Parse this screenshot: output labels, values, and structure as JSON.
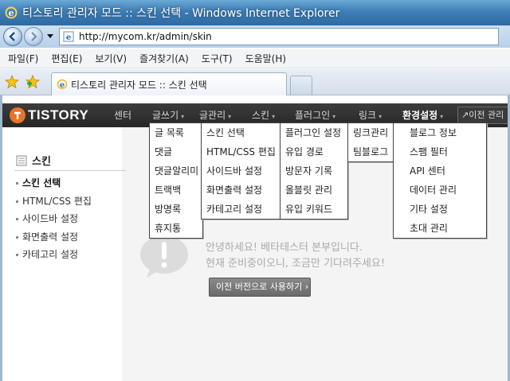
{
  "window": {
    "title": "티스토리 관리자 모드 :: 스킨 선택 - Windows Internet Explorer"
  },
  "address": {
    "url": "http://mycom.kr/admin/skin"
  },
  "menubar": {
    "items": [
      "파일(F)",
      "편집(E)",
      "보기(V)",
      "즐겨찾기(A)",
      "도구(T)",
      "도움말(H)"
    ]
  },
  "tab": {
    "title": "티스토리 관리자 모드 :: 스킨 선택"
  },
  "nav": {
    "logo": "TISTORY",
    "items": [
      "센터",
      "글쓰기",
      "글관리",
      "스킨",
      "플러그인",
      "링크",
      "환경설정"
    ],
    "prev_admin": "이전 관리"
  },
  "dropdowns": {
    "write": [
      "글 목록",
      "댓글",
      "댓글알리미",
      "트랙백",
      "방명록",
      "휴지통"
    ],
    "skin": [
      "스킨 선택",
      "HTML/CSS 편집",
      "사이드바 설정",
      "화면출력 설정",
      "카테고리 설정"
    ],
    "plugin": [
      "플러그인 설정",
      "유입 경로",
      "방문자 기록",
      "올블릿 관리",
      "유입 키워드"
    ],
    "link": [
      "링크관리",
      "팀블로그"
    ],
    "settings": [
      "블로그 정보",
      "스팸 필터",
      "API 센터",
      "데이터 관리",
      "기타 설정",
      "초대 관리"
    ]
  },
  "sidebar": {
    "title": "스킨",
    "items": [
      "스킨 선택",
      "HTML/CSS 편집",
      "사이드바 설정",
      "화면출력 설정",
      "카테고리 설정"
    ]
  },
  "notice": {
    "line1": "안녕하세요! 베타테스터 본부입니다.",
    "line2": "현재 준비중이오니, 조금만 기다려주세요!",
    "button": "이전 버전으로 사용하기 ›"
  },
  "colors": {
    "nav_bg": "#2c2c2c",
    "logo_accent": "#e8732c",
    "ie_title": "#3f7fb6"
  }
}
